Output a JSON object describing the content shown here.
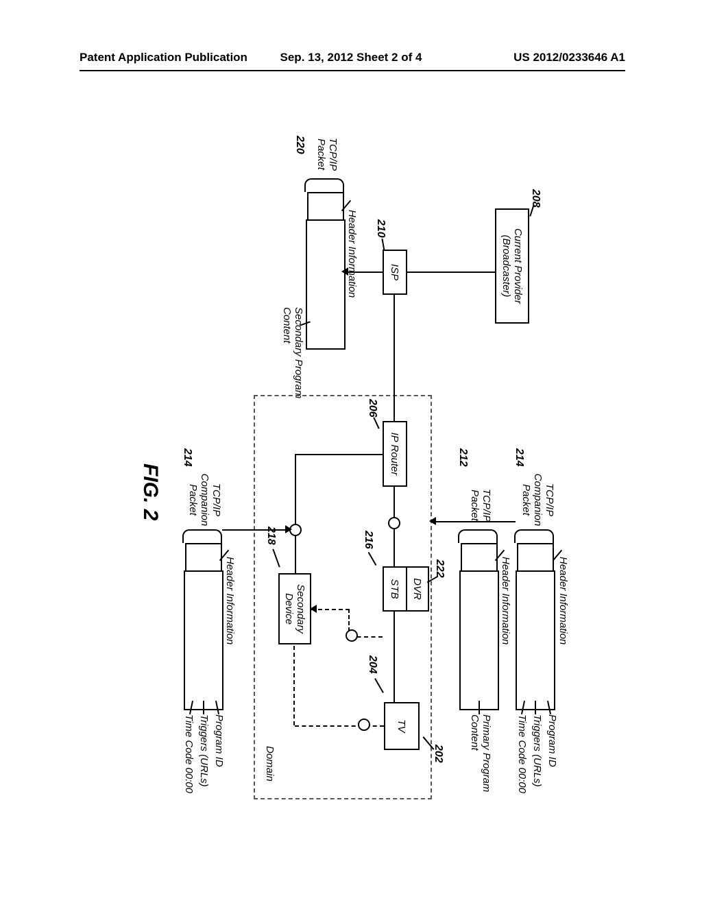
{
  "header": {
    "left": "Patent Application Publication",
    "center": "Sep. 13, 2012  Sheet 2 of 4",
    "right": "US 2012/0233646 A1"
  },
  "figure_label": "FIG. 2",
  "refs": {
    "r202": "202",
    "r204": "204",
    "r206": "206",
    "r208": "208",
    "r210": "210",
    "r212": "212",
    "r214a": "214",
    "r214b": "214",
    "r216": "216",
    "r218": "218",
    "r220": "220",
    "r222": "222"
  },
  "boxes": {
    "provider": "Current Provider\n(Broadcaster)",
    "isp": "ISP",
    "ip_router": "IP Router",
    "stb": "STB",
    "dvr": "DVR",
    "tv": "TV",
    "secondary_device": "Secondary\nDevice",
    "domain": "Domain"
  },
  "packets": {
    "companion_a": {
      "brace": "TCP/IP\nCompanion\nPacket",
      "header_label": "Header Information",
      "fields": [
        "Program ID",
        "Triggers (URLs)",
        "Time Code 00:00"
      ]
    },
    "primary": {
      "brace": "TCP/IP\nPacket",
      "header_label": "Header Information",
      "payload_label": "Primary Program\nContent"
    },
    "secondary": {
      "brace": "TCP/IP\nPacket",
      "header_label": "Header Information",
      "payload_label": "Secondary Program\nContent"
    },
    "companion_b": {
      "brace": "TCP/IP\nCompanion\nPacket",
      "header_label": "Header Information",
      "fields": [
        "Program ID",
        "Triggers (URLs)",
        "Time Code 00:00"
      ]
    }
  }
}
